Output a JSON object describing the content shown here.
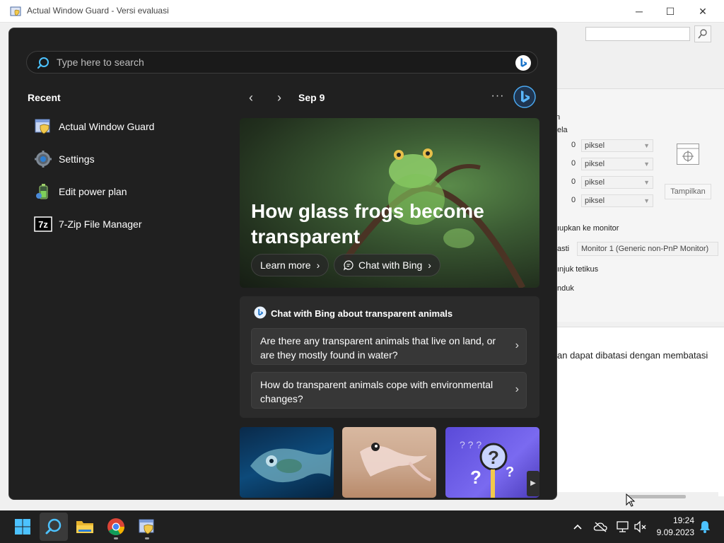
{
  "background_window": {
    "title": "Actual Window Guard - Versi evaluasi",
    "controls": {
      "minimize": "─",
      "maximize": "☐",
      "close": "✕"
    },
    "fragments": {
      "n": "n",
      "ela": "ela",
      "value1": "0",
      "value2": "0",
      "value3": "0",
      "value4": "0",
      "unit": "piksel",
      "show_button": "Tampilkan",
      "monitor_heading": "ıupkan ke monitor",
      "asti": "asti",
      "monitor_select": "Monitor 1 (Generic non-PnP Monitor)",
      "tetikus": "ınjuk tetikus",
      "nduk": "nduk",
      "limit_text": "an dapat dibatasi dengan membatasi"
    }
  },
  "start_menu": {
    "search": {
      "placeholder": "Type here to search"
    },
    "recent": {
      "title": "Recent",
      "items": [
        {
          "label": "Actual Window Guard",
          "icon": "window-guard-icon"
        },
        {
          "label": "Settings",
          "icon": "gear-icon"
        },
        {
          "label": "Edit power plan",
          "icon": "battery-icon"
        },
        {
          "label": "7-Zip File Manager",
          "icon": "7zip-icon"
        }
      ]
    },
    "feed": {
      "date": "Sep 9",
      "more": "···",
      "hero": {
        "title": "How glass frogs become transparent",
        "learn_more": "Learn more",
        "chat_with_bing": "Chat with Bing"
      },
      "chat_card": {
        "title": "Chat with Bing about transparent animals",
        "questions": [
          "Are there any transparent animals that live on land, or are they mostly found in water?",
          "How do transparent animals cope with environmental changes?"
        ]
      }
    }
  },
  "taskbar": {
    "time": "19:24",
    "date": "9.09.2023",
    "colors": {
      "accent": "#4cc2ff",
      "background": "#202020"
    }
  }
}
